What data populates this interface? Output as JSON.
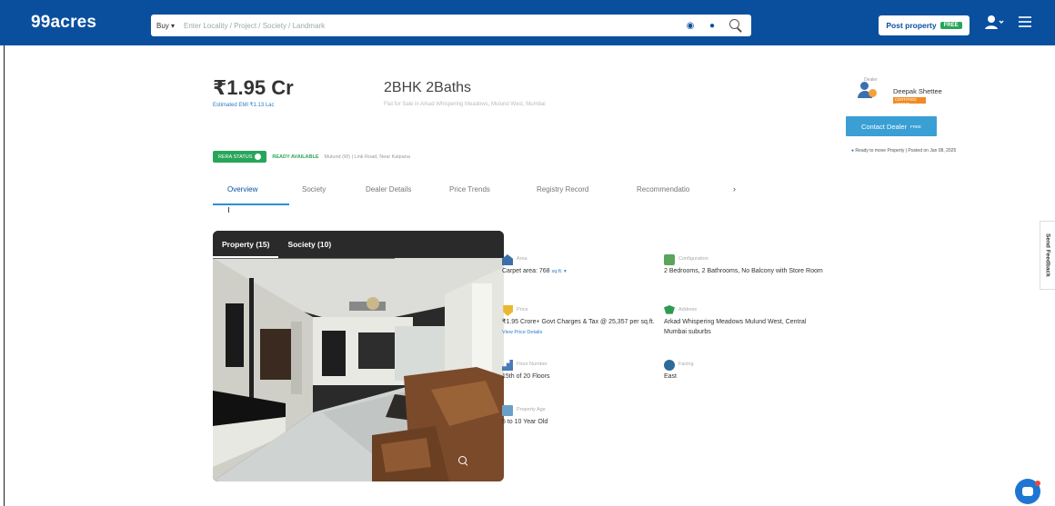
{
  "navbar": {
    "logo": "99acres",
    "search_type": "Buy ▾",
    "search_placeholder": "Enter Locality / Project / Society / Landmark",
    "post_property_label": "Post property",
    "free_badge": "FREE"
  },
  "header": {
    "price": "₹1.95 Cr",
    "price_sub": "Estimated EMI ₹1.13 Lac",
    "config_title": "2BHK 2Baths",
    "config_sub": "Flat for Sale in Arkad Whispering Meadows, Mulund West, Mumbai",
    "status_badge": "RERA STATUS",
    "ready": "READY AVAILABLE",
    "address": "Mulund (W) | Link Road, Near Kalpana"
  },
  "tabs": [
    "Overview",
    "Society",
    "Dealer Details",
    "Price Trends",
    "Registry Record",
    "Recommendatio"
  ],
  "gallery": {
    "tabs": [
      "Property (15)",
      "Society (10)"
    ]
  },
  "details": {
    "area": {
      "label": "Area",
      "value": "Carpet area: 768",
      "link": "sq.ft. ▾"
    },
    "configuration": {
      "label": "Configuration",
      "value": "2 Bedrooms, 2 Bathrooms, No Balcony with Store Room"
    },
    "price": {
      "label": "Price",
      "value": "₹1.95 Crore+ Govt Charges & Tax @ 25,357 per sq.ft.",
      "link": "View Price Details"
    },
    "address": {
      "label": "Address",
      "value": "Arkad Whispering Meadows Mulund West, Central Mumbai suburbs"
    },
    "floor": {
      "label": "Floor Number",
      "value": "15th of 20 Floors"
    },
    "facing": {
      "label": "Facing",
      "value": "East"
    },
    "age": {
      "label": "Property Age",
      "value": "5 to 10 Year Old"
    }
  },
  "agent": {
    "role": "Dealer",
    "name": "Deepak Shettee",
    "tag": "CERTIFIED AGENT",
    "tag_note": "",
    "contact_label": "Contact Dealer",
    "contact_sup": "FREE",
    "meta": "Ready to move Property | Posted on Jan 08, 2025"
  },
  "feedback_label": "Send Feedback",
  "colors": {
    "brand": "#0a4f9e",
    "accent": "#2b8fd6",
    "success": "#29a55a",
    "warning": "#f08a24"
  }
}
